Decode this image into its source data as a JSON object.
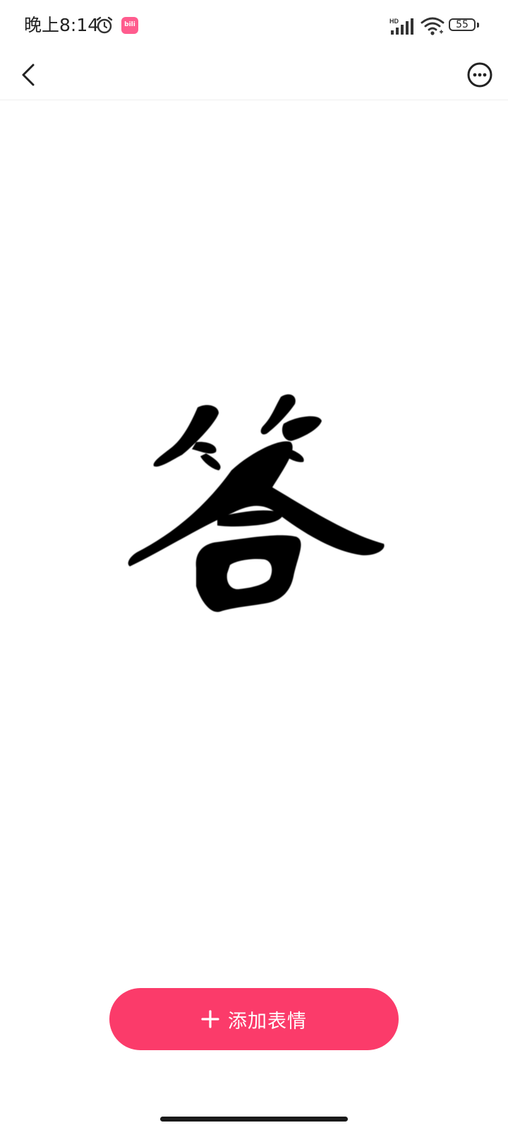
{
  "status_bar": {
    "time": "晚上8:14",
    "app_badge_text": "bili",
    "network_label": "HD",
    "battery_level": "55",
    "icons": [
      "alarm-icon",
      "bilibili-app-icon",
      "signal-icon",
      "wifi-icon",
      "battery-icon"
    ]
  },
  "nav": {
    "back_icon": "chevron-left-icon",
    "more_icon": "more-options-icon"
  },
  "sticker": {
    "character": "答"
  },
  "add_button": {
    "label": "添加表情",
    "icon": "plus-icon"
  },
  "colors": {
    "accent": "#fb3b6a",
    "text": "#222222",
    "background": "#ffffff"
  }
}
